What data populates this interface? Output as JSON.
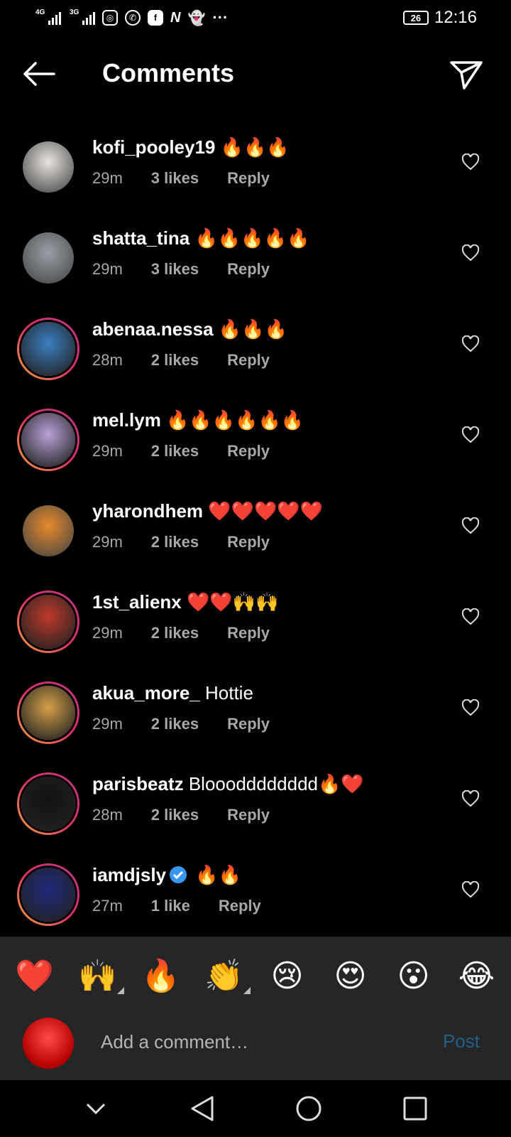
{
  "status_bar": {
    "network1": "4G",
    "network2": "3G",
    "battery": "26",
    "time": "12:16",
    "icons": [
      "instagram-icon",
      "whatsapp-icon",
      "facebook-icon",
      "news-icon",
      "snapchat-icon",
      "more-dots-icon"
    ]
  },
  "header": {
    "title": "Comments"
  },
  "comments": [
    {
      "user": "kofi_pooley19",
      "text": " 🔥🔥🔥",
      "time": "29m",
      "likes": "3 likes",
      "reply": "Reply",
      "ring": false,
      "avatar_color": "#e8e4e0"
    },
    {
      "user": "shatta_tina",
      "text": " 🔥🔥🔥🔥🔥",
      "time": "29m",
      "likes": "3 likes",
      "reply": "Reply",
      "ring": false,
      "avatar_color": "#9aa0a8"
    },
    {
      "user": "abenaa.nessa",
      "text": " 🔥🔥🔥",
      "time": "28m",
      "likes": "2 likes",
      "reply": "Reply",
      "ring": true,
      "avatar_color": "#3b7fc0"
    },
    {
      "user": "mel.lym",
      "text": " 🔥🔥🔥🔥🔥🔥",
      "time": "29m",
      "likes": "2 likes",
      "reply": "Reply",
      "ring": true,
      "avatar_color": "#b9a2d8"
    },
    {
      "user": "yharondhem",
      "text": " ❤️❤️❤️❤️❤️",
      "time": "29m",
      "likes": "2 likes",
      "reply": "Reply",
      "ring": false,
      "avatar_color": "#e58a2c"
    },
    {
      "user": "1st_alienx",
      "text": " ❤️❤️🙌🙌",
      "time": "29m",
      "likes": "2 likes",
      "reply": "Reply",
      "ring": true,
      "avatar_color": "#c0392b"
    },
    {
      "user": "akua_more_",
      "text": " Hottie",
      "time": "29m",
      "likes": "2 likes",
      "reply": "Reply",
      "ring": true,
      "avatar_color": "#d4a04a"
    },
    {
      "user": "parisbeatz",
      "text": " Blooodddddddd🔥❤️",
      "time": "28m",
      "likes": "2 likes",
      "reply": "Reply",
      "ring": true,
      "avatar_color": "#111111"
    },
    {
      "user": "iamdjsly",
      "text": " 🔥🔥",
      "time": "27m",
      "likes": "1 like",
      "reply": "Reply",
      "ring": true,
      "verified": true,
      "avatar_color": "#1f2a7a"
    }
  ],
  "emoji_bar": [
    "❤️",
    "🙌",
    "🔥",
    "👏",
    "😢",
    "😍",
    "😮",
    "😂"
  ],
  "compose": {
    "placeholder": "Add a comment…",
    "post_label": "Post"
  },
  "colors": {
    "background": "#000000",
    "panel": "#262626",
    "muted_text": "#a8a8a8",
    "post_disabled": "#1f5f86",
    "story_ring": "#d8306a"
  }
}
